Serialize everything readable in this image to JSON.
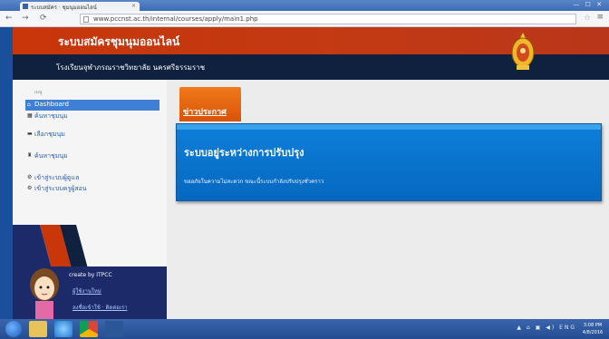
{
  "browser": {
    "tab_title": "ระบบสมัคร · ชุมนุมออนไลน์",
    "tab_close": "×",
    "window_controls": "— ☐ ✕",
    "back": "←",
    "forward": "→",
    "reload": "⟳",
    "url": "www.pccnst.ac.th/internal/courses/apply/main1.php",
    "star": "☆",
    "menu": "≡"
  },
  "header": {
    "site_title": "ระบบสมัครชุมนุมออนไลน์",
    "school_name": "โรงเรียนจุฬาภรณราชวิทยาลัย นครศรีธรรมราช",
    "emblem_icon": "royal-emblem-icon"
  },
  "sidebar": {
    "small_label": "เมนู",
    "items": [
      {
        "label": "Dashboard",
        "icon": "⌂"
      },
      {
        "label": "ค้นหาชุมนุม",
        "icon": "▦"
      },
      {
        "label": "เลือกชุมนุม",
        "icon": "▬"
      },
      {
        "label": "ค้นหาชุมนุม",
        "icon": "♜"
      },
      {
        "label": "เข้าสู่ระบบผู้ดูแล",
        "icon": "⚙"
      },
      {
        "label": "เข้าสู่ระบบครูผู้สอน",
        "icon": "⚙"
      }
    ],
    "credit": "create by ITPCC",
    "user_link_1": "ผู้ใช้งานใหม่",
    "user_link_2": "ลงชื่อเข้าใช้ · ติดต่อเรา"
  },
  "content": {
    "news_tab": "ข่าวประกาศ",
    "panel_title": "ระบบอยู่ระหว่างการปรับปรุง",
    "panel_text": "ขออภัยในความไม่สะดวก ขณะนี้ระบบกำลังปรับปรุงชั่วคราว"
  },
  "taskbar": {
    "apps": [
      "start-orb",
      "file-explorer-icon",
      "internet-explorer-icon",
      "chrome-icon",
      "word-icon"
    ],
    "tray": "▲ ⌂ ▣ ◀) ENG",
    "time": "3:08 PM",
    "date": "4/8/2016"
  },
  "colors": {
    "header_red": "#c8360a",
    "header_dark": "#10213f",
    "panel_blue": "#0b73cf",
    "news_orange": "#ea6a12",
    "active_item": "#3f7fd6"
  }
}
